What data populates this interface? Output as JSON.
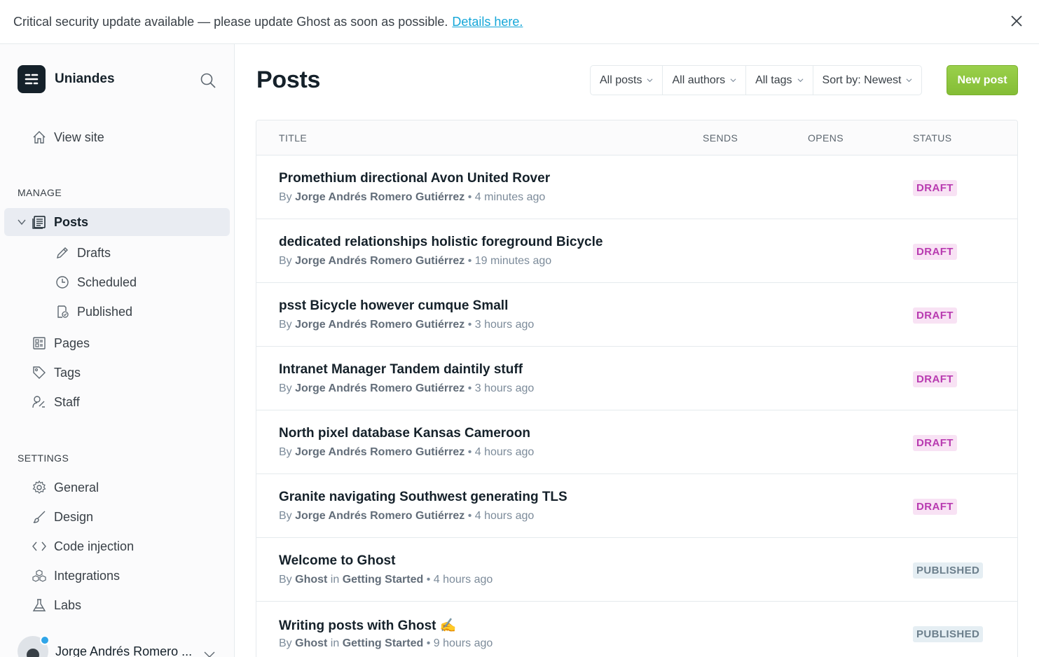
{
  "banner": {
    "message": "Critical security update available — please update Ghost as soon as possible.",
    "link_label": "Details here."
  },
  "sidebar": {
    "brand_name": "Uniandes",
    "view_site": "View site",
    "manage_heading": "MANAGE",
    "posts": "Posts",
    "drafts": "Drafts",
    "scheduled": "Scheduled",
    "published": "Published",
    "pages": "Pages",
    "tags": "Tags",
    "staff": "Staff",
    "settings_heading": "SETTINGS",
    "general": "General",
    "design": "Design",
    "code_injection": "Code injection",
    "integrations": "Integrations",
    "labs": "Labs",
    "user_name": "Jorge Andrés Romero ..."
  },
  "main": {
    "title": "Posts",
    "filters": {
      "type": "All posts",
      "authors": "All authors",
      "tags": "All tags",
      "sort": "Sort by: Newest"
    },
    "new_post": "New post",
    "columns": {
      "title": "TITLE",
      "sends": "SENDS",
      "opens": "OPENS",
      "status": "STATUS"
    },
    "posts": [
      {
        "title": "Promethium directional Avon United Rover",
        "by": "By",
        "author": "Jorge Andrés Romero Gutiérrez",
        "in": "",
        "tag": "",
        "time": "• 4 minutes ago",
        "status": "DRAFT"
      },
      {
        "title": "dedicated relationships holistic foreground Bicycle",
        "by": "By",
        "author": "Jorge Andrés Romero Gutiérrez",
        "in": "",
        "tag": "",
        "time": "• 19 minutes ago",
        "status": "DRAFT"
      },
      {
        "title": "psst Bicycle however cumque Small",
        "by": "By",
        "author": "Jorge Andrés Romero Gutiérrez",
        "in": "",
        "tag": "",
        "time": "• 3 hours ago",
        "status": "DRAFT"
      },
      {
        "title": "Intranet Manager Tandem daintily stuff",
        "by": "By",
        "author": "Jorge Andrés Romero Gutiérrez",
        "in": "",
        "tag": "",
        "time": "• 3 hours ago",
        "status": "DRAFT"
      },
      {
        "title": "North pixel database Kansas Cameroon",
        "by": "By",
        "author": "Jorge Andrés Romero Gutiérrez",
        "in": "",
        "tag": "",
        "time": "• 4 hours ago",
        "status": "DRAFT"
      },
      {
        "title": "Granite navigating Southwest generating TLS",
        "by": "By",
        "author": "Jorge Andrés Romero Gutiérrez",
        "in": "",
        "tag": "",
        "time": "• 4 hours ago",
        "status": "DRAFT"
      },
      {
        "title": "Welcome to Ghost",
        "by": "By",
        "author": "Ghost",
        "in": "in",
        "tag": "Getting Started",
        "time": "• 4 hours ago",
        "status": "PUBLISHED"
      },
      {
        "title": "Writing posts with Ghost ✍️",
        "by": "By",
        "author": "Ghost",
        "in": "in",
        "tag": "Getting Started",
        "time": "• 9 hours ago",
        "status": "PUBLISHED"
      }
    ]
  }
}
